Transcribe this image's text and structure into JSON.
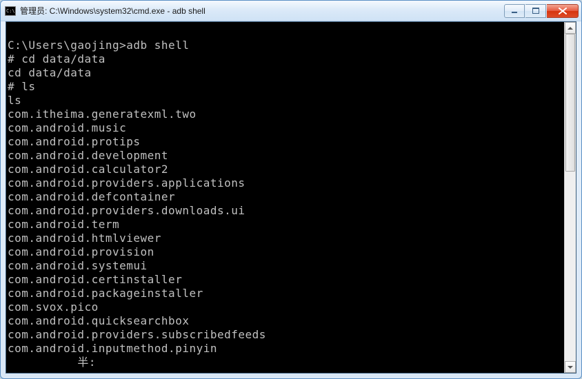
{
  "window": {
    "title_icon_text": "C:\\",
    "title": "管理员: C:\\Windows\\system32\\cmd.exe - adb  shell"
  },
  "terminal": {
    "lines": [
      "",
      "C:\\Users\\gaojing>adb shell",
      "# cd data/data",
      "cd data/data",
      "# ls",
      "ls",
      "com.itheima.generatexml.two",
      "com.android.music",
      "com.android.protips",
      "com.android.development",
      "com.android.calculator2",
      "com.android.providers.applications",
      "com.android.defcontainer",
      "com.android.providers.downloads.ui",
      "com.android.term",
      "com.android.htmlviewer",
      "com.android.provision",
      "com.android.systemui",
      "com.android.certinstaller",
      "com.android.packageinstaller",
      "com.svox.pico",
      "com.android.quicksearchbox",
      "com.android.providers.subscribedfeeds",
      "com.android.inputmethod.pinyin",
      "          半:"
    ]
  }
}
